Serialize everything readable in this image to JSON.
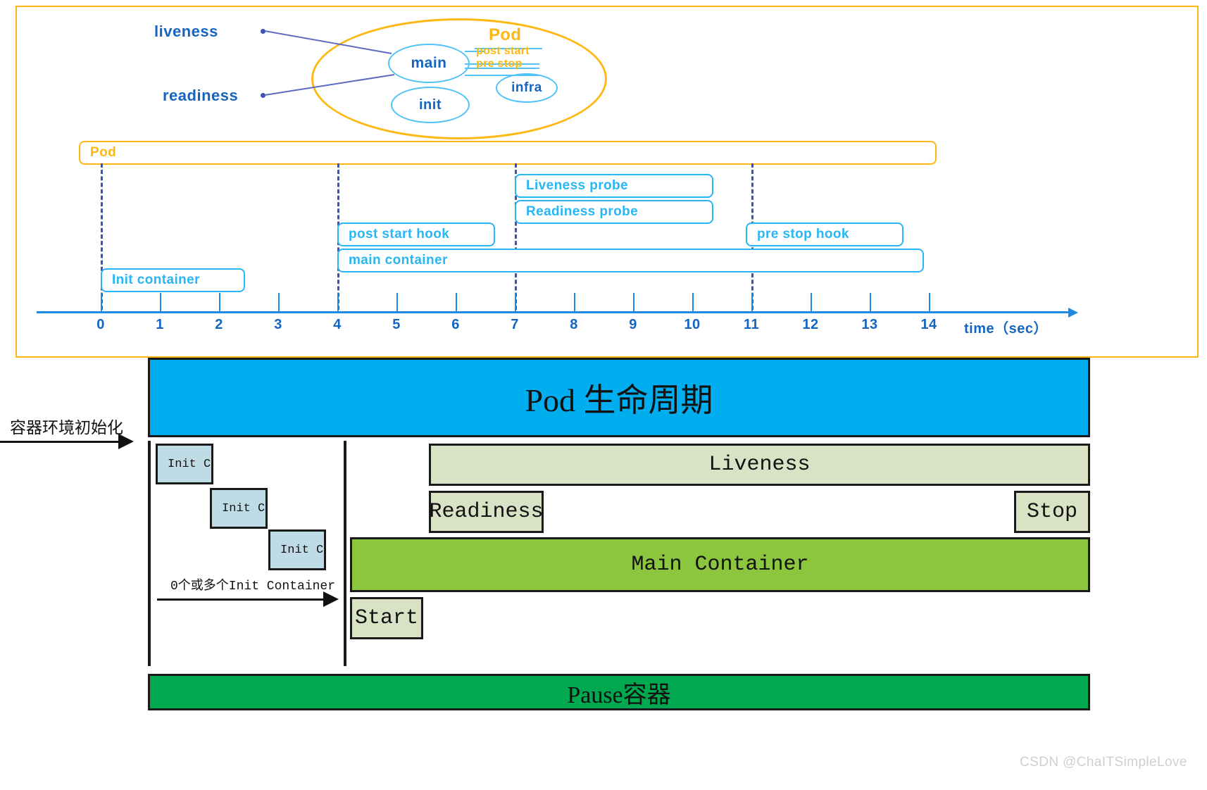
{
  "top_diagram": {
    "pod_label": "Pod",
    "containers": [
      {
        "name": "main"
      },
      {
        "name": "init"
      },
      {
        "name": "infra"
      }
    ],
    "hooks": [
      {
        "label": "post start"
      },
      {
        "label": "pre stop"
      }
    ],
    "probe_callouts": [
      {
        "label": "liveness"
      },
      {
        "label": "readiness"
      }
    ]
  },
  "timeline": {
    "pod_bar_label": "Pod",
    "bars": [
      {
        "label": "Liveness probe",
        "start": 7,
        "end": 11
      },
      {
        "label": "Readiness probe",
        "start": 7,
        "end": 11
      },
      {
        "label": "post start hook",
        "start": 4,
        "end": 7
      },
      {
        "label": "pre stop hook",
        "start": 11,
        "end": 14.6
      },
      {
        "label": "main container",
        "start": 4,
        "end": 14.9
      },
      {
        "label": "Init container",
        "start": 0,
        "end": 3.4
      }
    ],
    "event_markers": [
      0,
      4,
      7,
      11
    ],
    "axis": {
      "ticks": [
        "0",
        "1",
        "2",
        "3",
        "4",
        "5",
        "6",
        "7",
        "8",
        "9",
        "10",
        "11",
        "12",
        "13",
        "14"
      ],
      "unit_label": "time（sec）"
    }
  },
  "bottom_diagram": {
    "title": "Pod 生命周期",
    "entry_arrow_label": "容器环境初始化",
    "init_containers": [
      {
        "label": "Init C"
      },
      {
        "label": "Init C"
      },
      {
        "label": "Init C"
      }
    ],
    "init_note": "0个或多个Init Container",
    "phases": [
      {
        "label": "Liveness"
      },
      {
        "label": "Readiness"
      },
      {
        "label": "Stop"
      },
      {
        "label": "Main Container"
      },
      {
        "label": "Start"
      }
    ],
    "pause_container": "Pause容器"
  },
  "watermark": "CSDN @ChaITSimpleLove",
  "colors": {
    "pod_orange": "#FDB813",
    "probe_blue": "#29B6F6",
    "dark_blue": "#1565C0",
    "marker_indigo": "#3F51B5",
    "title_cyan": "#00AEEF",
    "init_box": "#BFDCE6",
    "probe_box": "#D9E2C4",
    "main_green": "#8CC63F",
    "pause_green": "#00A850"
  }
}
